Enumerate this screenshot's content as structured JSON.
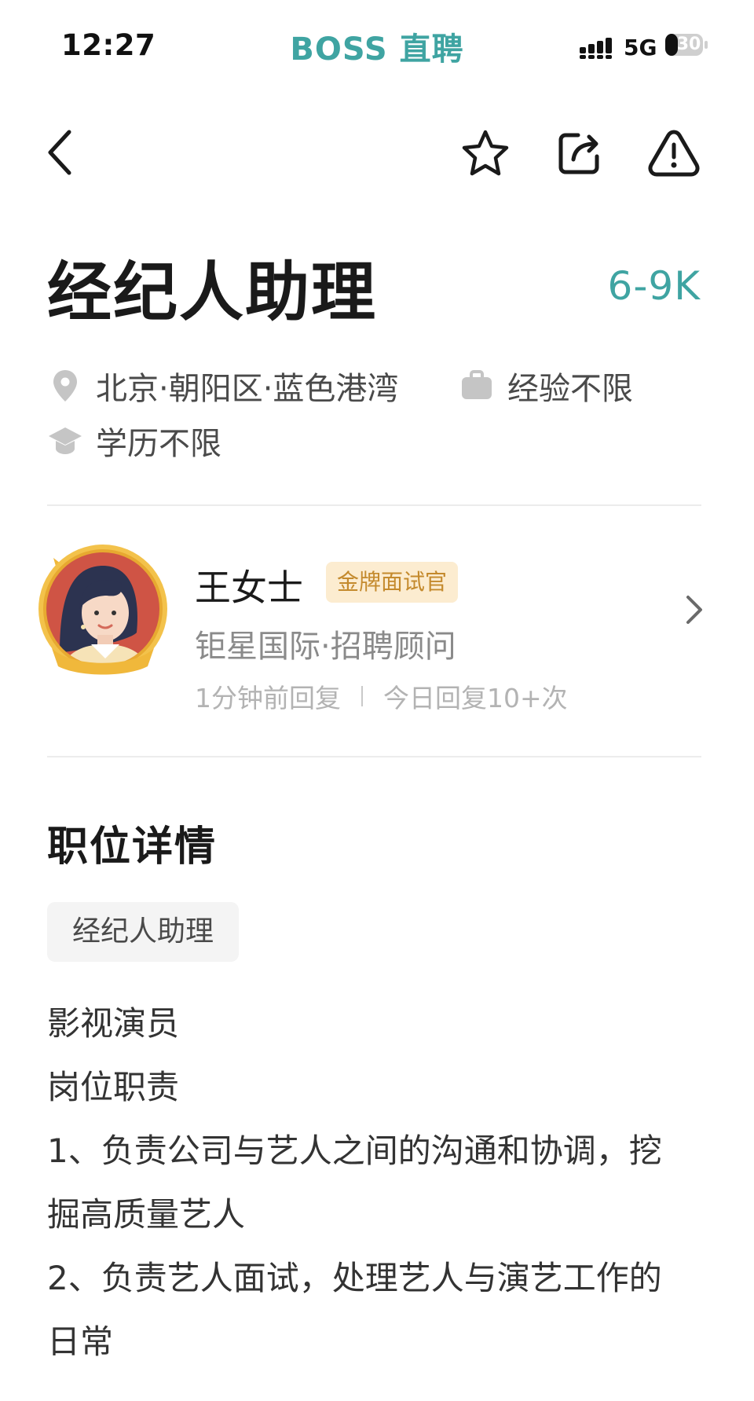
{
  "status_bar": {
    "time": "12:27",
    "brand": "BOSS 直聘",
    "network": "5G",
    "battery": "30"
  },
  "nav": {
    "icons": [
      "back-icon",
      "star-icon",
      "share-icon",
      "report-icon"
    ]
  },
  "job": {
    "title": "经纪人助理",
    "salary": "6-9K",
    "location": "北京·朝阳区·蓝色港湾",
    "experience": "经验不限",
    "education": "学历不限"
  },
  "recruiter": {
    "name": "王女士",
    "badge": "金牌面试官",
    "company": "钜星国际·招聘顾问",
    "reply_time": "1分钟前回复",
    "reply_count": "今日回复10+次"
  },
  "details": {
    "section_title": "职位详情",
    "tag": "经纪人助理",
    "lines": [
      "影视演员",
      "岗位职责",
      "1、负责公司与艺人之间的沟通和协调，挖",
      "掘高质量艺人",
      "2、负责艺人面试，处理艺人与演艺工作的",
      "日常"
    ]
  },
  "colors": {
    "accent": "#3fa4a2",
    "badge_bg": "#fcecd0",
    "badge_text": "#c48a2d"
  }
}
